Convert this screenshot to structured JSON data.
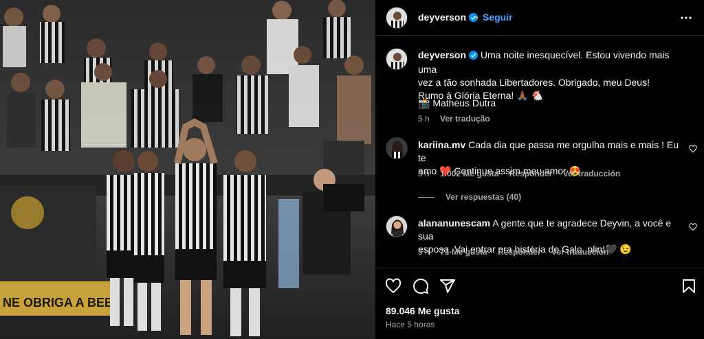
{
  "post": {
    "username": "deyverson",
    "follow_label": "Seguir",
    "separator": "•",
    "caption_line1": "Uma noite inesquecível. Estou vivendo mais uma",
    "caption_line2": "vez a tão sonhada Libertadores. Obrigado, meu Deus!",
    "caption_line3": "Rumo à Glória Eterna! 🙏🏾 🐔",
    "credit": "📸 Matheus Dutra",
    "caption_age": "5 h",
    "see_translation": "Ver tradução",
    "likes": "89.046 Me gusta",
    "posted": "Hace 5 horas",
    "photo_banner_text": "NE OBRIGA A BEB"
  },
  "comments": [
    {
      "username": "kariina.mv",
      "text_line1": "Cada dia que passa me orgulha mais e mais ! Eu te",
      "text_line2": "amo ❤️  Continue assim meu amor 😍",
      "age": "5 h",
      "likes": "1.002 Me gusta",
      "reply": "Responder",
      "translate": "Ver traducción"
    },
    {
      "username": "alananunescam",
      "text_line1": "A gente que te agradece Deyvin, a você e sua",
      "text_line2": "esposa. Vai entrar pra história do Galo, plin!🖤 😉",
      "age": "5 h",
      "likes": "71 Me gusta",
      "reply": "Responder",
      "translate": "Ver traducción"
    }
  ],
  "view_replies": "Ver respuestas (40)",
  "colors": {
    "background": "#000000",
    "text": "#f5f5f5",
    "muted": "#a8a8a8",
    "link_blue": "#4aa3ff",
    "verified_blue": "#0095f6",
    "divider": "#262626"
  },
  "icons": [
    "verified-badge-icon",
    "more-options-icon",
    "heart-icon",
    "comment-icon",
    "share-icon",
    "save-icon"
  ]
}
